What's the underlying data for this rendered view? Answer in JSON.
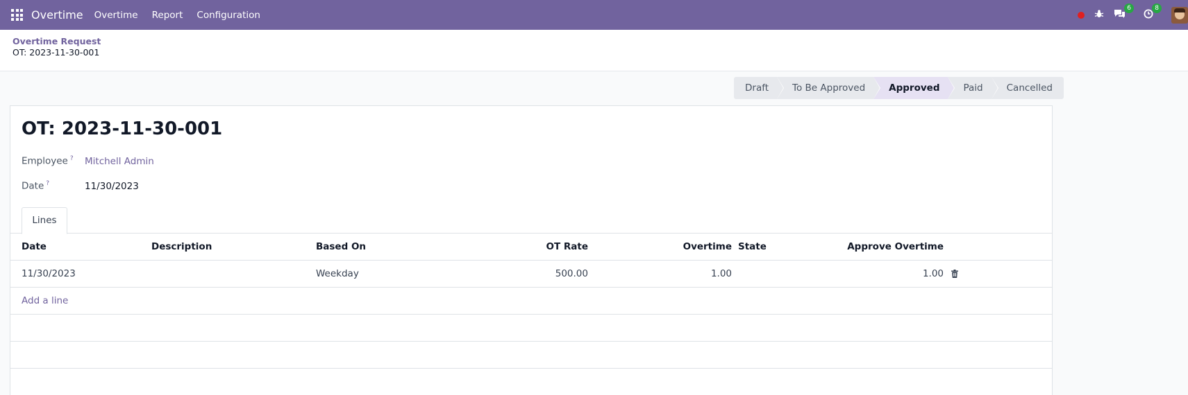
{
  "navbar": {
    "brand": "Overtime",
    "menu": [
      "Overtime",
      "Report",
      "Configuration"
    ],
    "messages_count": "6",
    "activities_count": "8",
    "icons": [
      "apps-icon",
      "record-dot-icon",
      "bug-icon",
      "chat-icon",
      "clock-icon",
      "avatar"
    ]
  },
  "breadcrumb": {
    "parent": "Overtime Request",
    "current": "OT: 2023-11-30-001"
  },
  "statusbar": {
    "stages": [
      "Draft",
      "To Be Approved",
      "Approved",
      "Paid",
      "Cancelled"
    ],
    "active": "Approved"
  },
  "form": {
    "title": "OT: 2023-11-30-001",
    "employee_label": "Employee",
    "employee_value": "Mitchell Admin",
    "date_label": "Date",
    "date_value": "11/30/2023",
    "help_mark": "?"
  },
  "tabs": [
    "Lines"
  ],
  "table": {
    "headers": {
      "date": "Date",
      "description": "Description",
      "based_on": "Based On",
      "ot_rate": "OT Rate",
      "overtime": "Overtime",
      "state": "State",
      "approve_overtime": "Approve Overtime"
    },
    "rows": [
      {
        "date": "11/30/2023",
        "description": "",
        "based_on": "Weekday",
        "ot_rate": "500.00",
        "overtime": "1.00",
        "state": "",
        "approve_overtime": "1.00"
      }
    ],
    "add_line": "Add a line"
  },
  "colors": {
    "brand": "#71639e",
    "active_stage": "#e6e1f3",
    "stage": "#e7e9ed",
    "badge": "#28a745",
    "recording": "#e02020"
  }
}
